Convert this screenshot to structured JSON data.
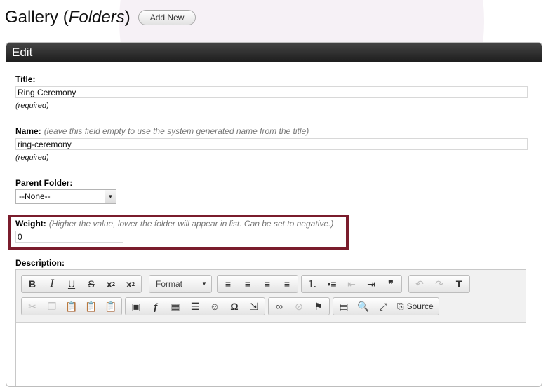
{
  "page": {
    "title_prefix": "Gallery (",
    "title_emphasis": "Folders",
    "title_suffix": ")",
    "add_new_label": "Add New"
  },
  "panel": {
    "header": "Edit"
  },
  "form": {
    "title": {
      "label": "Title:",
      "value": "Ring Ceremony",
      "note": "(required)"
    },
    "name": {
      "label": "Name:",
      "hint": "(leave this field empty to use the system generated name from the title)",
      "value": "ring-ceremony",
      "note": "(required)"
    },
    "parent_folder": {
      "label": "Parent Folder:",
      "selected": "--None--"
    },
    "weight": {
      "label": "Weight:",
      "hint": "(Higher the value, lower the folder will appear in list. Can be set to negative.)",
      "value": "0"
    },
    "description": {
      "label": "Description:"
    }
  },
  "editor": {
    "format_label": "Format",
    "source_label": "Source",
    "highlight_color": "#7a1c2c"
  },
  "icons": {
    "bold": "B",
    "italic": "I",
    "underline": "U",
    "strike": "S",
    "subscript": "x",
    "superscript": "x",
    "sub_mark": "2",
    "sup_mark": "2",
    "align_left": "≡",
    "align_center": "≡",
    "align_right": "≡",
    "justify": "≡",
    "numbered_list": "⒈",
    "bulleted_list": "•≡",
    "outdent": "⇤",
    "indent": "⇥",
    "blockquote": "❞",
    "undo": "↶",
    "redo": "↷",
    "remove_format": "T",
    "cut": "✂",
    "copy": "❐",
    "paste": "📋",
    "paste_text": "📋",
    "paste_word": "📋",
    "image": "▣",
    "flash": "ƒ",
    "table": "▦",
    "hr": "☰",
    "smiley": "☺",
    "omega": "Ω",
    "pagebreak": "⇲",
    "link": "∞",
    "unlink": "⊘",
    "anchor": "⚑",
    "templates": "▤",
    "preview": "🔍",
    "maximize": "⤢",
    "source": "⎘"
  }
}
